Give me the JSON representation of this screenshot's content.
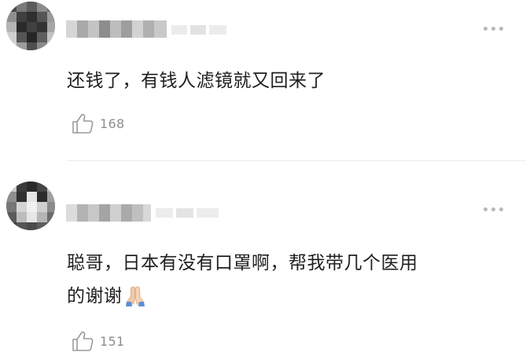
{
  "comments": [
    {
      "text": "还钱了，有钱人滤镜就又回来了",
      "likes": "168",
      "icons": {
        "like": "thumbs-up-icon",
        "more": "more-dots-icon"
      }
    },
    {
      "text_line1": "聪哥，日本有没有口罩啊，帮我带几个医用",
      "text_line2": "的谢谢",
      "emoji": "pray-emoji",
      "likes": "151",
      "icons": {
        "like": "thumbs-up-icon",
        "more": "more-dots-icon"
      }
    }
  ],
  "colors": {
    "text": "#1f1f1f",
    "secondary": "#8e8e8e",
    "divider": "#ececec",
    "dots": "#b8b8b8"
  }
}
